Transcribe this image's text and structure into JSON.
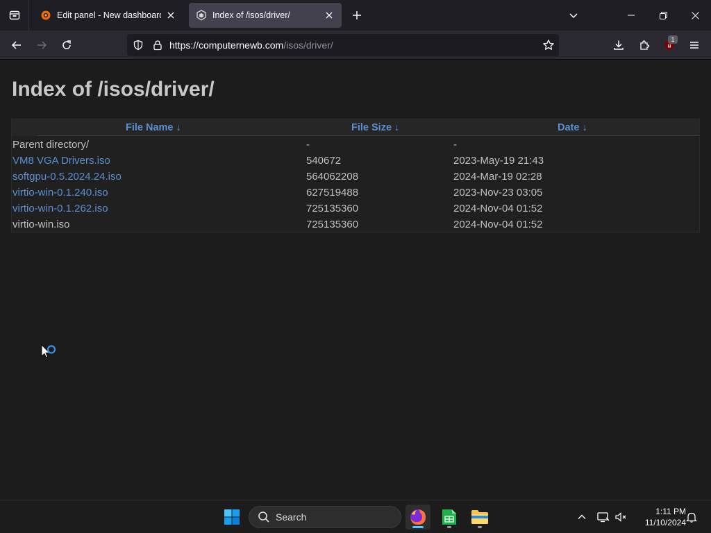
{
  "browser": {
    "tabs": [
      {
        "title": "Edit panel - New dashboard - D",
        "active": false
      },
      {
        "title": "Index of /isos/driver/",
        "active": true
      }
    ],
    "url": {
      "host": "https://computernewb.com",
      "path": "/isos/driver/"
    },
    "extension_badge": "1"
  },
  "page": {
    "title": "Index of /isos/driver/",
    "columns": [
      {
        "label": "File Name ↓"
      },
      {
        "label": "File Size ↓"
      },
      {
        "label": "Date ↓"
      }
    ],
    "rows": [
      {
        "name": "Parent directory/",
        "size": "-",
        "date": "-",
        "link": false
      },
      {
        "name": "VM8 VGA Drivers.iso",
        "size": "540672",
        "date": "2023-May-19 21:43",
        "link": true
      },
      {
        "name": "softgpu-0.5.2024.24.iso",
        "size": "564062208",
        "date": "2024-Mar-19 02:28",
        "link": true
      },
      {
        "name": "virtio-win-0.1.240.iso",
        "size": "627519488",
        "date": "2023-Nov-23 03:05",
        "link": true
      },
      {
        "name": "virtio-win-0.1.262.iso",
        "size": "725135360",
        "date": "2024-Nov-04 01:52",
        "link": true
      },
      {
        "name": "virtio-win.iso",
        "size": "725135360",
        "date": "2024-Nov-04 01:52",
        "link": false
      }
    ]
  },
  "taskbar": {
    "search_label": "Search",
    "time": "1:11 PM",
    "date": "11/10/2024"
  },
  "colors": {
    "link": "#5b8fd0",
    "plain_text": "#c0c0c0",
    "page_bg": "#1c1c1c",
    "browser_chrome": "#2b2a33"
  }
}
